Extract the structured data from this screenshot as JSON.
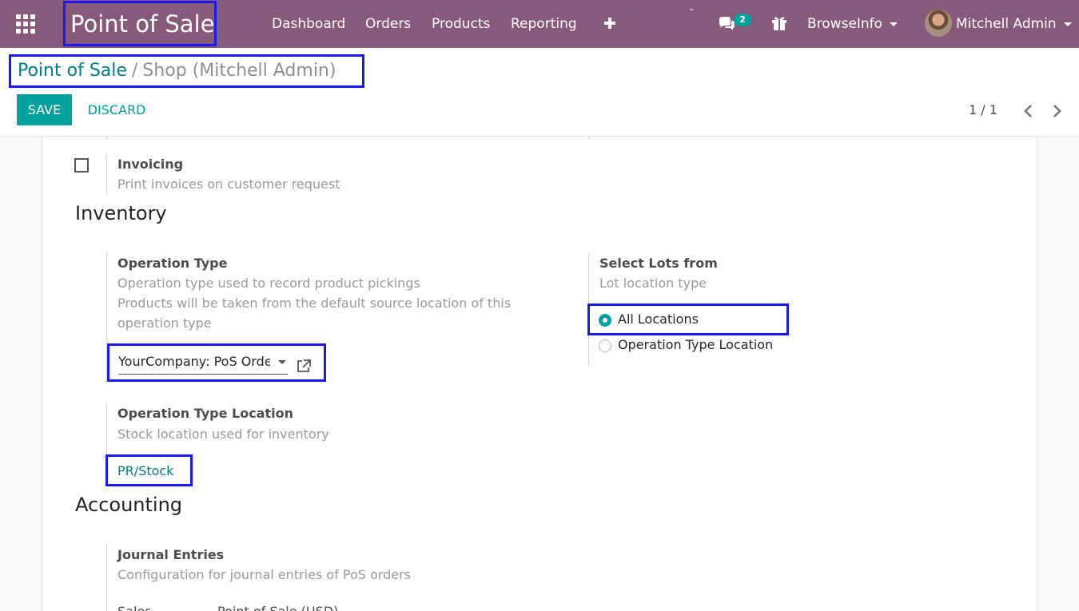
{
  "navbar": {
    "app_title": "Point of Sale",
    "menu": [
      "Dashboard",
      "Orders",
      "Products",
      "Reporting"
    ],
    "messages_count": "2",
    "company": "BrowseInfo",
    "user": "Mitchell Admin"
  },
  "breadcrumb": {
    "parent": "Point of Sale",
    "separator": "/",
    "current": "Shop (Mitchell Admin)"
  },
  "toolbar": {
    "save_label": "SAVE",
    "discard_label": "DISCARD",
    "pager": "1 / 1"
  },
  "form": {
    "invoicing": {
      "label": "Invoicing",
      "help": "Print invoices on customer request",
      "checked": false
    },
    "inventory": {
      "title": "Inventory",
      "operation_type": {
        "label": "Operation Type",
        "help": "Operation type used to record product pickings",
        "help2": "Products will be taken from the default source location of this operation type",
        "value": "YourCompany: PoS Orders"
      },
      "operation_type_location": {
        "label": "Operation Type Location",
        "help": "Stock location used for inventory",
        "value": "PR/Stock"
      },
      "select_lots": {
        "label": "Select Lots from",
        "help": "Lot location type",
        "options": [
          {
            "label": "All Locations",
            "selected": true
          },
          {
            "label": "Operation Type Location",
            "selected": false
          }
        ]
      }
    },
    "accounting": {
      "title": "Accounting",
      "journal_entries": {
        "label": "Journal Entries",
        "help": "Configuration for journal entries of PoS orders"
      },
      "sales": {
        "label": "Sales",
        "value": "Point of Sale (USD)"
      }
    }
  },
  "colors": {
    "navbar": "#875a7b",
    "primary": "#00a09d",
    "link": "#017e84",
    "highlight_border": "#1a1af0"
  }
}
